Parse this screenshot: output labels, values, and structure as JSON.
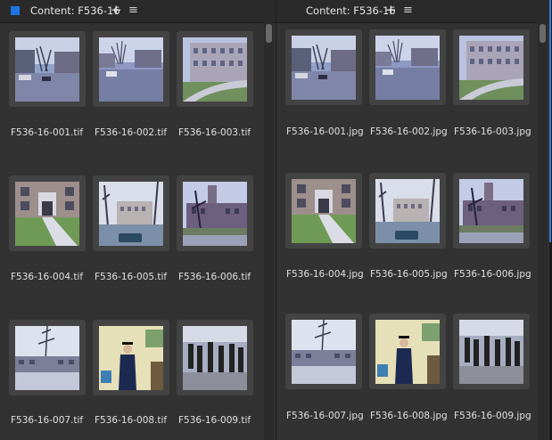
{
  "left_panel": {
    "title": "Content: F536-16",
    "plus_icon": "+",
    "menu_icon": "≡",
    "files": [
      {
        "name": "F536-16-001.tif",
        "thumb": "street"
      },
      {
        "name": "F536-16-002.tif",
        "thumb": "houses"
      },
      {
        "name": "F536-16-003.tif",
        "thumb": "building"
      },
      {
        "name": "F536-16-004.tif",
        "thumb": "entrance"
      },
      {
        "name": "F536-16-005.tif",
        "thumb": "campus"
      },
      {
        "name": "F536-16-006.tif",
        "thumb": "church"
      },
      {
        "name": "F536-16-007.tif",
        "thumb": "lake"
      },
      {
        "name": "F536-16-008.tif",
        "thumb": "graduate"
      },
      {
        "name": "F536-16-009.tif",
        "thumb": "procession"
      }
    ]
  },
  "right_panel": {
    "title": "Content: F536-16",
    "plus_icon": "+",
    "menu_icon": "≡",
    "files": [
      {
        "name": "F536-16-001.jpg",
        "thumb": "street"
      },
      {
        "name": "F536-16-002.jpg",
        "thumb": "houses"
      },
      {
        "name": "F536-16-003.jpg",
        "thumb": "building"
      },
      {
        "name": "F536-16-004.jpg",
        "thumb": "entrance"
      },
      {
        "name": "F536-16-005.jpg",
        "thumb": "campus"
      },
      {
        "name": "F536-16-006.jpg",
        "thumb": "church"
      },
      {
        "name": "F536-16-007.jpg",
        "thumb": "lake"
      },
      {
        "name": "F536-16-008.jpg",
        "thumb": "graduate"
      },
      {
        "name": "F536-16-009.jpg",
        "thumb": "procession"
      }
    ]
  },
  "colors": {
    "accent": "#1f74e6",
    "panel_bg": "#323232",
    "tile_bg": "#434343"
  }
}
